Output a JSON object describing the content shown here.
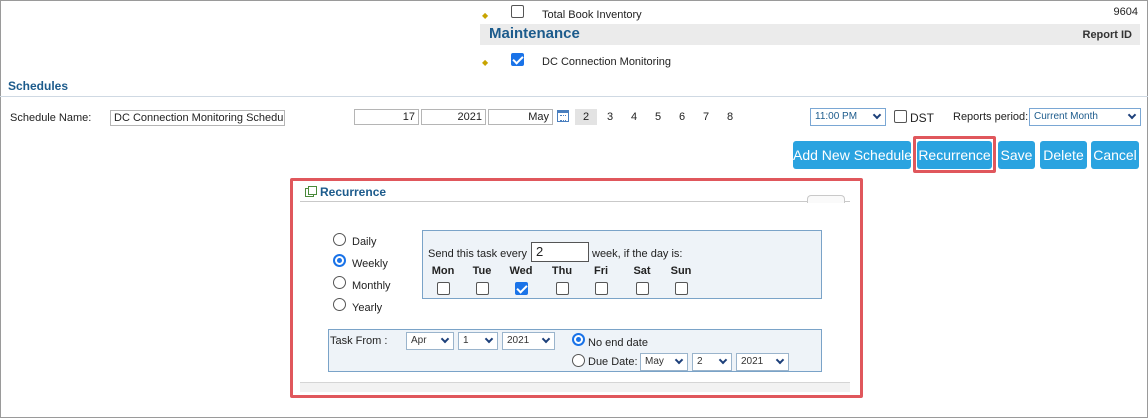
{
  "reports": {
    "items": [
      {
        "label": "Total Book Inventory",
        "value": "9604",
        "checked": false
      },
      {
        "label": "DC Connection Monitoring",
        "checked": true
      }
    ],
    "group_title": "Maintenance",
    "report_id_label": "Report ID"
  },
  "schedules": {
    "title": "Schedules",
    "name_label": "Schedule Name:",
    "name_value": "DC Connection Monitoring Schedu",
    "day": "17",
    "year": "2021",
    "month": "May",
    "week_numbers": [
      "2",
      "3",
      "4",
      "5",
      "6",
      "7",
      "8"
    ],
    "selected_week": "2",
    "time": "11:00 PM",
    "dst_label": "DST",
    "reports_period_label": "Reports period:",
    "reports_period_value": "Current Month"
  },
  "buttons": {
    "add_new": "Add New Schedule",
    "recurrence": "Recurrence",
    "save": "Save",
    "delete": "Delete",
    "cancel": "Cancel"
  },
  "recurrence": {
    "title": "Recurrence",
    "frequencies": [
      "Daily",
      "Weekly",
      "Monthly",
      "Yearly"
    ],
    "selected_frequency": "Weekly",
    "send_every_prefix": "Send this task every",
    "send_every_value": "2",
    "send_every_suffix": "week, if the day is:",
    "days": [
      {
        "label": "Mon",
        "checked": false
      },
      {
        "label": "Tue",
        "checked": false
      },
      {
        "label": "Wed",
        "checked": true
      },
      {
        "label": "Thu",
        "checked": false
      },
      {
        "label": "Fri",
        "checked": false
      },
      {
        "label": "Sat",
        "checked": false
      },
      {
        "label": "Sun",
        "checked": false
      }
    ],
    "task_from_label": "Task From :",
    "task_from_month": "Apr",
    "task_from_day": "1",
    "task_from_year": "2021",
    "no_end_label": "No end date",
    "due_date_label": "Due Date:",
    "due_month": "May",
    "due_day": "2",
    "due_year": "2021",
    "end_option": "No end date"
  },
  "colors": {
    "accent_button": "#2aa3e0",
    "heading": "#1c5b8c",
    "highlight": "#e0575c"
  }
}
